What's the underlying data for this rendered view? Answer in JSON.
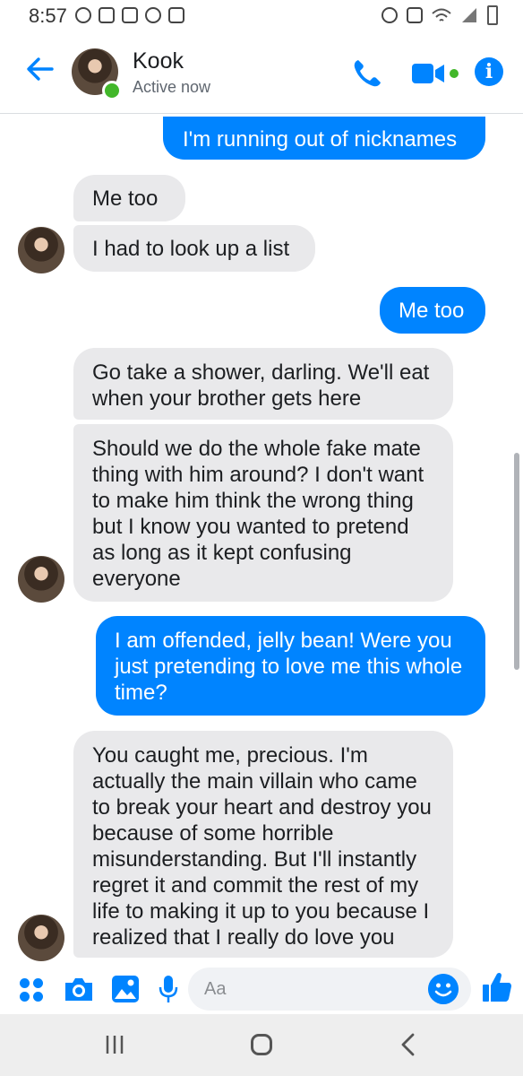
{
  "status_bar": {
    "time": "8:57"
  },
  "header": {
    "contact_name": "Kook",
    "contact_status": "Active now",
    "info_glyph": "i",
    "icons": [
      "back-arrow-icon",
      "phone-icon",
      "video-camera-icon",
      "info-icon"
    ]
  },
  "messages": [
    {
      "sender": "me",
      "text": "I'm running out of nicknames"
    },
    {
      "sender": "Kook",
      "text": "Me too"
    },
    {
      "sender": "Kook",
      "text": "I had to look up a list"
    },
    {
      "sender": "me",
      "text": "Me too"
    },
    {
      "sender": "Kook",
      "text": "Go take a shower, darling. We'll eat when your brother gets here"
    },
    {
      "sender": "Kook",
      "text": "Should we do the whole fake mate thing with him around? I don't want to make him think the wrong thing but I know you wanted to pretend as long as it kept confusing everyone"
    },
    {
      "sender": "me",
      "text": "I am offended, jelly bean! Were you just pretending to love me this whole time?"
    },
    {
      "sender": "Kook",
      "text": "You caught me, precious. I'm actually the main villain who came to break your heart and destroy you because of some horrible misunderstanding. But I'll instantly regret it and commit the rest of my life to making it up to you because I realized that I really do love you"
    }
  ],
  "composer": {
    "placeholder": "Aa",
    "icons": [
      "apps-icon",
      "camera-icon",
      "gallery-icon",
      "microphone-icon",
      "emoji-icon",
      "thumbs-up-icon"
    ]
  },
  "colors": {
    "accent": "#0084ff",
    "incoming_bubble": "#e9e9eb",
    "active_dot": "#42b72a"
  }
}
